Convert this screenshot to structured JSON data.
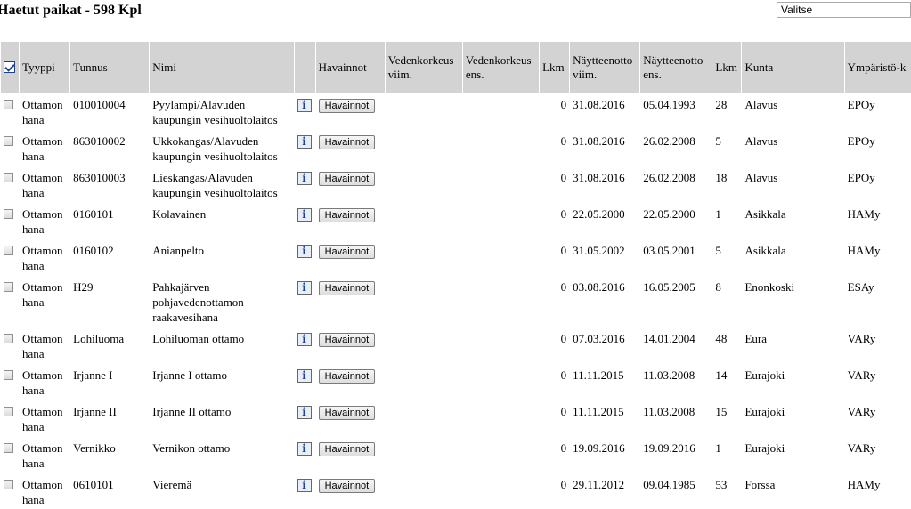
{
  "page": {
    "title": "Haetut paikat - 598 Kpl",
    "select_value": "Valitse"
  },
  "table": {
    "headers": {
      "type": "Tyyppi",
      "code": "Tunnus",
      "name": "Nimi",
      "observations": "Havainnot",
      "water_level_last": "Vedenkorkeus viim.",
      "water_level_first": "Vedenkorkeus ens.",
      "count": "Lkm",
      "sample_last": "Näytteenotto viim.",
      "sample_first": "Näytteenotto ens.",
      "sample_count": "Lkm",
      "municipality": "Kunta",
      "env_center": "Ympäristö-k"
    },
    "observation_button_label": "Havainnot",
    "info_icon_glyph": "i",
    "rows": [
      {
        "type": "Ottamon hana",
        "code": "010010004",
        "name": "Pyylampi/Alavuden kaupungin vesihuoltolaitos",
        "wl_last": "",
        "wl_first": "",
        "count": "0",
        "s_last": "31.08.2016",
        "s_first": "05.04.1993",
        "s_count": "28",
        "municipality": "Alavus",
        "env": "EPOy"
      },
      {
        "type": "Ottamon hana",
        "code": "863010002",
        "name": "Ukkokangas/Alavuden kaupungin vesihuoltolaitos",
        "wl_last": "",
        "wl_first": "",
        "count": "0",
        "s_last": "31.08.2016",
        "s_first": "26.02.2008",
        "s_count": "5",
        "municipality": "Alavus",
        "env": "EPOy"
      },
      {
        "type": "Ottamon hana",
        "code": "863010003",
        "name": "Lieskangas/Alavuden kaupungin vesihuoltolaitos",
        "wl_last": "",
        "wl_first": "",
        "count": "0",
        "s_last": "31.08.2016",
        "s_first": "26.02.2008",
        "s_count": "18",
        "municipality": "Alavus",
        "env": "EPOy"
      },
      {
        "type": "Ottamon hana",
        "code": "0160101",
        "name": "Kolavainen",
        "wl_last": "",
        "wl_first": "",
        "count": "0",
        "s_last": "22.05.2000",
        "s_first": "22.05.2000",
        "s_count": "1",
        "municipality": "Asikkala",
        "env": "HAMy"
      },
      {
        "type": "Ottamon hana",
        "code": "0160102",
        "name": "Anianpelto",
        "wl_last": "",
        "wl_first": "",
        "count": "0",
        "s_last": "31.05.2002",
        "s_first": "03.05.2001",
        "s_count": "5",
        "municipality": "Asikkala",
        "env": "HAMy"
      },
      {
        "type": "Ottamon hana",
        "code": "H29",
        "name": "Pahkajärven pohjavedenottamon raakavesihana",
        "wl_last": "",
        "wl_first": "",
        "count": "0",
        "s_last": "03.08.2016",
        "s_first": "16.05.2005",
        "s_count": "8",
        "municipality": "Enonkoski",
        "env": "ESAy"
      },
      {
        "type": "Ottamon hana",
        "code": "Lohiluoma",
        "name": "Lohiluoman ottamo",
        "wl_last": "",
        "wl_first": "",
        "count": "0",
        "s_last": "07.03.2016",
        "s_first": "14.01.2004",
        "s_count": "48",
        "municipality": "Eura",
        "env": "VARy"
      },
      {
        "type": "Ottamon hana",
        "code": "Irjanne I",
        "name": "Irjanne I ottamo",
        "wl_last": "",
        "wl_first": "",
        "count": "0",
        "s_last": "11.11.2015",
        "s_first": "11.03.2008",
        "s_count": "14",
        "municipality": "Eurajoki",
        "env": "VARy"
      },
      {
        "type": "Ottamon hana",
        "code": "Irjanne II",
        "name": "Irjanne II ottamo",
        "wl_last": "",
        "wl_first": "",
        "count": "0",
        "s_last": "11.11.2015",
        "s_first": "11.03.2008",
        "s_count": "15",
        "municipality": "Eurajoki",
        "env": "VARy"
      },
      {
        "type": "Ottamon hana",
        "code": "Vernikko",
        "name": "Vernikon ottamo",
        "wl_last": "",
        "wl_first": "",
        "count": "0",
        "s_last": "19.09.2016",
        "s_first": "19.09.2016",
        "s_count": "1",
        "municipality": "Eurajoki",
        "env": "VARy"
      },
      {
        "type": "Ottamon hana",
        "code": "0610101",
        "name": "Vieremä",
        "wl_last": "",
        "wl_first": "",
        "count": "0",
        "s_last": "29.11.2012",
        "s_first": "09.04.1985",
        "s_count": "53",
        "municipality": "Forssa",
        "env": "HAMy"
      }
    ]
  }
}
